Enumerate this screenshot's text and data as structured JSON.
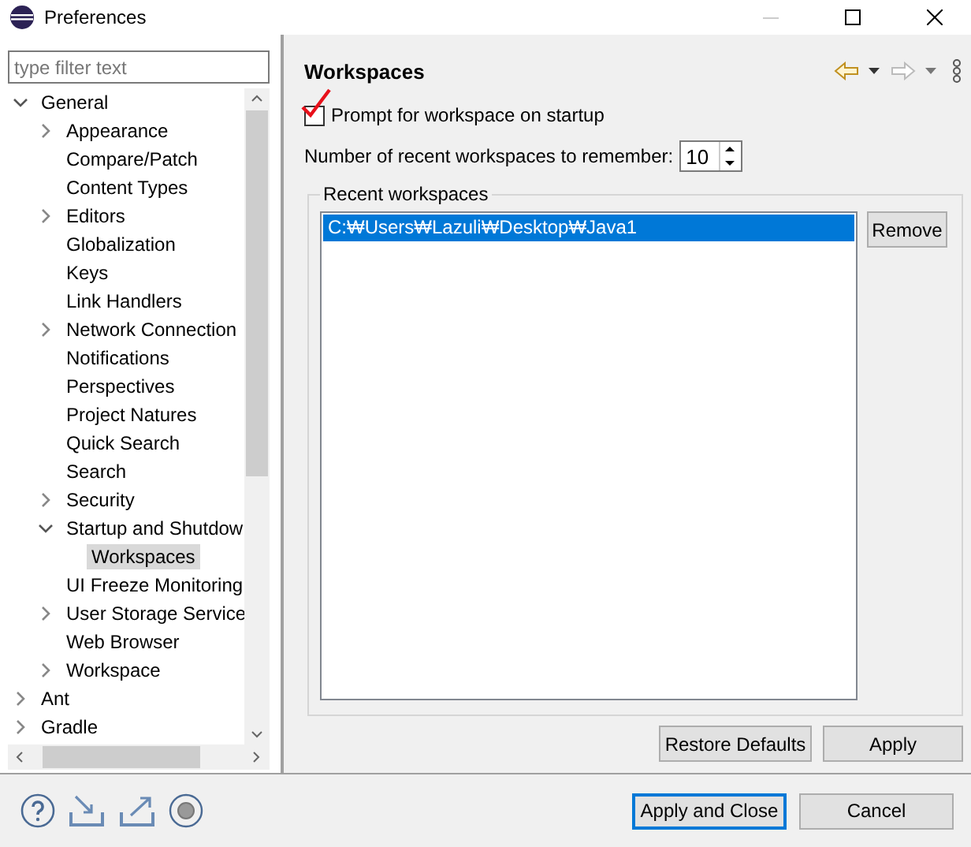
{
  "window": {
    "title": "Preferences"
  },
  "filter": {
    "placeholder": "type filter text"
  },
  "tree": [
    {
      "label": "General",
      "expanded": true,
      "selected": false,
      "children": [
        {
          "label": "Appearance",
          "expanded": false,
          "selected": false
        },
        {
          "label": "Compare/Patch",
          "selected": false
        },
        {
          "label": "Content Types",
          "selected": false
        },
        {
          "label": "Editors",
          "expanded": false,
          "selected": false
        },
        {
          "label": "Globalization",
          "selected": false
        },
        {
          "label": "Keys",
          "selected": false
        },
        {
          "label": "Link Handlers",
          "selected": false
        },
        {
          "label": "Network Connection",
          "expanded": false,
          "selected": false
        },
        {
          "label": "Notifications",
          "selected": false
        },
        {
          "label": "Perspectives",
          "selected": false
        },
        {
          "label": "Project Natures",
          "selected": false
        },
        {
          "label": "Quick Search",
          "selected": false
        },
        {
          "label": "Search",
          "selected": false
        },
        {
          "label": "Security",
          "expanded": false,
          "selected": false
        },
        {
          "label": "Startup and Shutdow",
          "expanded": true,
          "selected": false,
          "children": [
            {
              "label": "Workspaces",
              "selected": true
            }
          ]
        },
        {
          "label": "UI Freeze Monitoring",
          "selected": false
        },
        {
          "label": "User Storage Service",
          "expanded": false,
          "selected": false
        },
        {
          "label": "Web Browser",
          "selected": false
        },
        {
          "label": "Workspace",
          "expanded": false,
          "selected": false
        }
      ]
    },
    {
      "label": "Ant",
      "expanded": false,
      "selected": false
    },
    {
      "label": "Gradle",
      "expanded": false,
      "selected": false
    }
  ],
  "page": {
    "title": "Workspaces",
    "prompt": {
      "label": "Prompt for workspace on startup",
      "checked": true
    },
    "recent_count": {
      "label": "Number of recent workspaces to remember:",
      "value": "10"
    },
    "group": {
      "title": "Recent workspaces",
      "items": [
        {
          "path": "C:₩Users₩Lazuli₩Desktop₩Java1",
          "selected": true
        }
      ],
      "remove": "Remove"
    },
    "buttons": [
      "Restore Defaults",
      "Apply"
    ]
  },
  "footer": {
    "buttons": [
      {
        "label": "Apply and Close",
        "default": true
      },
      {
        "label": "Cancel",
        "default": false
      }
    ]
  }
}
